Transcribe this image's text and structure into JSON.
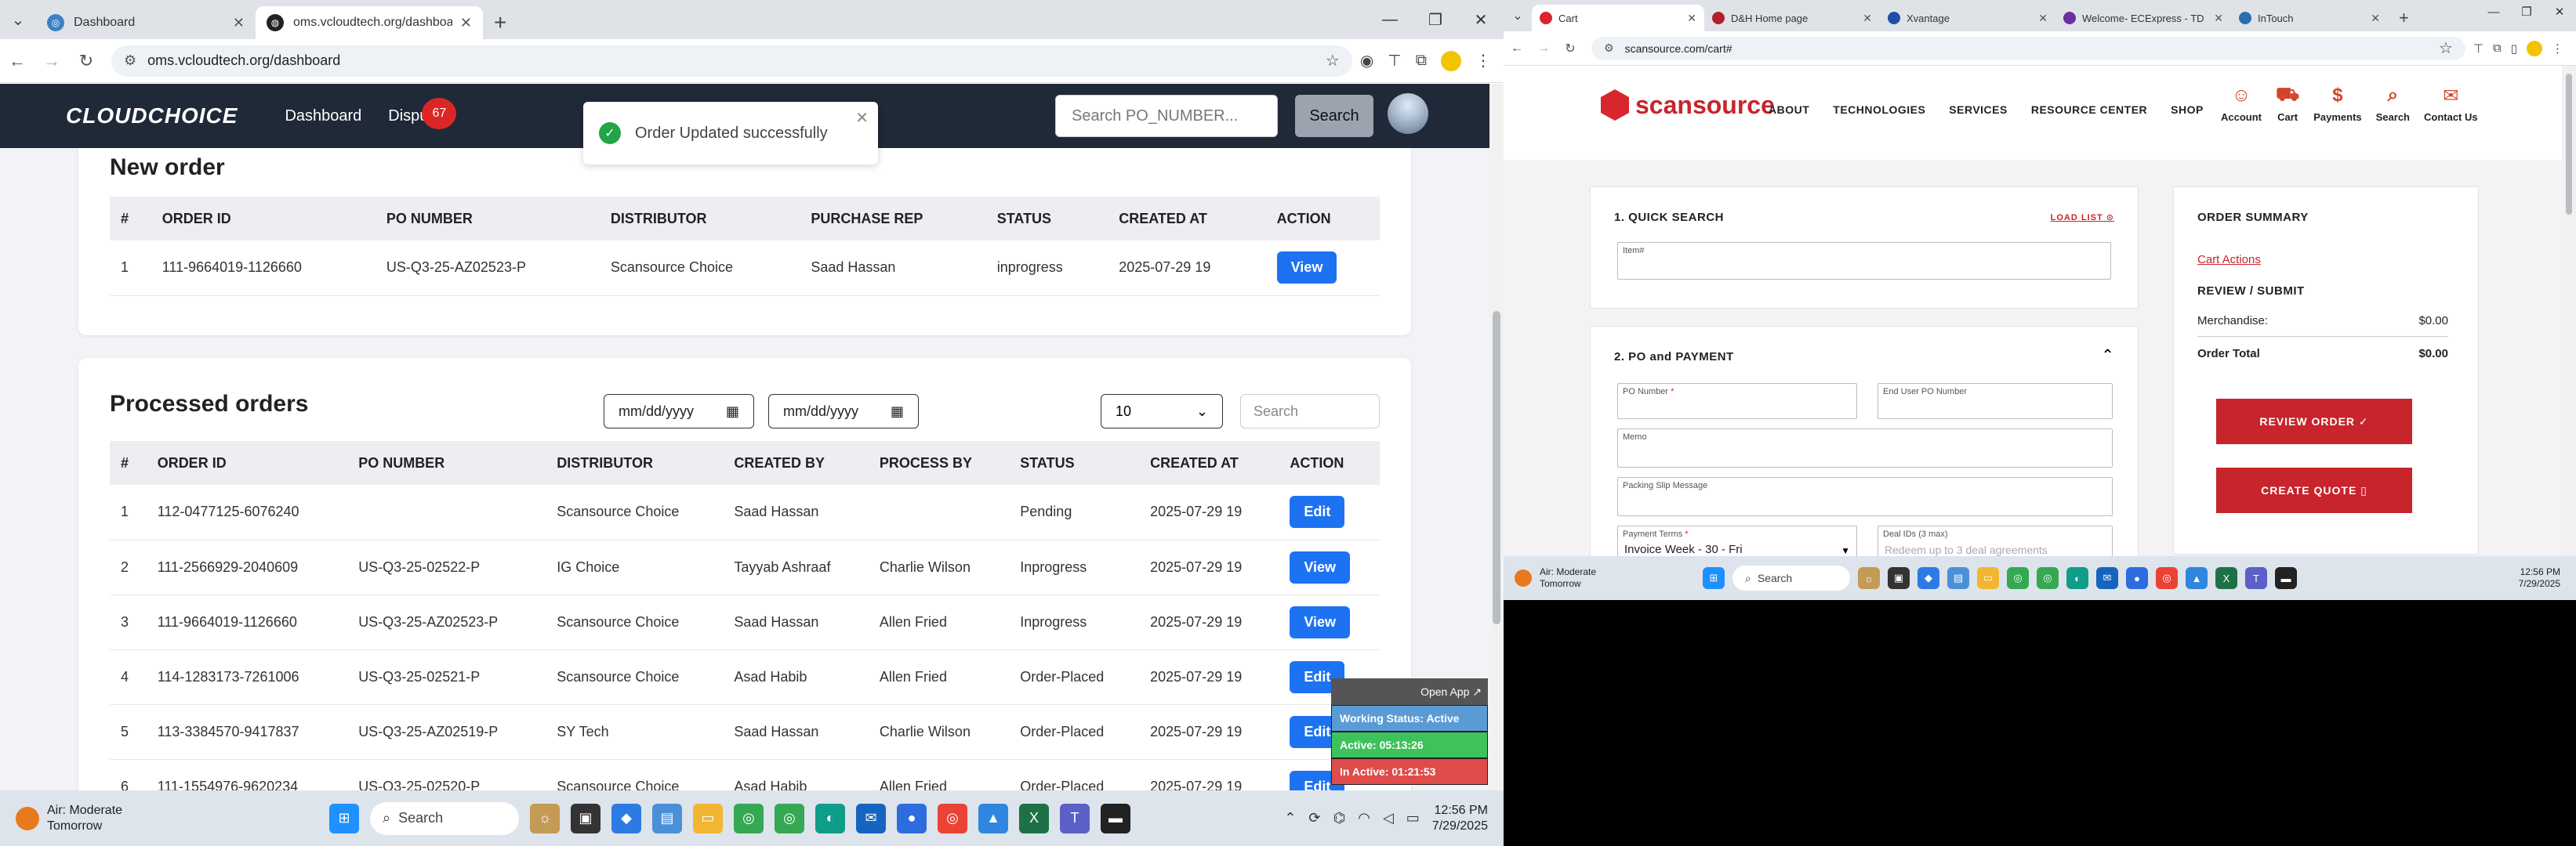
{
  "left": {
    "tabs": [
      {
        "title": "Dashboard",
        "color": "#3b82c4",
        "active": false
      },
      {
        "title": "oms.vcloudtech.org/dashboard",
        "color": "#222222",
        "active": true
      }
    ],
    "url": "oms.vcloudtech.org/dashboard",
    "app": {
      "logo": "CLOUDCHOICE",
      "nav_dashboard": "Dashboard",
      "nav_disputes": "Dispu",
      "disputes_badge": "67",
      "search_placeholder": "Search PO_NUMBER...",
      "search_button": "Search"
    },
    "toast": {
      "message": "Order Updated successfully"
    },
    "new_order": {
      "title": "New order",
      "columns": [
        "#",
        "ORDER ID",
        "PO NUMBER",
        "DISTRIBUTOR",
        "PURCHASE REP",
        "STATUS",
        "CREATED AT",
        "ACTION"
      ],
      "rows": [
        {
          "n": "1",
          "order_id": "111-9664019-1126660",
          "po": "US-Q3-25-AZ02523-P",
          "distributor": "Scansource Choice",
          "rep": "Saad Hassan",
          "status": "inprogress",
          "created": "2025-07-29 19",
          "action": "View"
        }
      ]
    },
    "processed": {
      "title": "Processed orders",
      "date_from": "mm/dd/yyyy",
      "date_to": "mm/dd/yyyy",
      "page_size": "10",
      "search_placeholder": "Search",
      "columns": [
        "#",
        "ORDER ID",
        "PO NUMBER",
        "DISTRIBUTOR",
        "CREATED BY",
        "PROCESS BY",
        "STATUS",
        "CREATED AT",
        "ACTION"
      ],
      "rows": [
        {
          "n": "1",
          "order_id": "112-0477125-6076240",
          "po": "",
          "distributor": "Scansource Choice",
          "created_by": "Saad Hassan",
          "process_by": "",
          "status": "Pending",
          "created": "2025-07-29 19",
          "action": "Edit"
        },
        {
          "n": "2",
          "order_id": "111-2566929-2040609",
          "po": "US-Q3-25-02522-P",
          "distributor": "IG Choice",
          "created_by": "Tayyab Ashraaf",
          "process_by": "Charlie Wilson",
          "status": "Inprogress",
          "created": "2025-07-29 19",
          "action": "View"
        },
        {
          "n": "3",
          "order_id": "111-9664019-1126660",
          "po": "US-Q3-25-AZ02523-P",
          "distributor": "Scansource Choice",
          "created_by": "Saad Hassan",
          "process_by": "Allen Fried",
          "status": "Inprogress",
          "created": "2025-07-29 19",
          "action": "View"
        },
        {
          "n": "4",
          "order_id": "114-1283173-7261006",
          "po": "US-Q3-25-02521-P",
          "distributor": "Scansource Choice",
          "created_by": "Asad Habib",
          "process_by": "Allen Fried",
          "status": "Order-Placed",
          "created": "2025-07-29 19",
          "action": "Edit"
        },
        {
          "n": "5",
          "order_id": "113-3384570-9417837",
          "po": "US-Q3-25-AZ02519-P",
          "distributor": "SY Tech",
          "created_by": "Saad Hassan",
          "process_by": "Charlie Wilson",
          "status": "Order-Placed",
          "created": "2025-07-29 19",
          "action": "Edit"
        },
        {
          "n": "6",
          "order_id": "111-1554976-9620234",
          "po": "US-Q3-25-02520-P",
          "distributor": "Scansource Choice",
          "created_by": "Asad Habib",
          "process_by": "Allen Fried",
          "status": "Order-Placed",
          "created": "2025-07-29 19",
          "action": "Edit"
        }
      ]
    },
    "status_widget": {
      "open_app": "Open App ↗",
      "working": "Working Status: Active",
      "active": "Active: 05:13:26",
      "inactive": "In Active: 01:21:53"
    },
    "taskbar": {
      "weather": "Air: Moderate",
      "weather_sub": "Tomorrow",
      "search": "Search",
      "time": "12:56 PM",
      "date": "7/29/2025"
    }
  },
  "right": {
    "tabs": [
      {
        "title": "Cart",
        "color": "#d7262d",
        "active": true
      },
      {
        "title": "D&H Home page",
        "color": "#b3202a",
        "active": false
      },
      {
        "title": "Xvantage",
        "color": "#1f4fa8",
        "active": false
      },
      {
        "title": "Welcome- ECExpress - TD S",
        "color": "#6a2fa0",
        "active": false
      },
      {
        "title": "InTouch",
        "color": "#2b6cb0",
        "active": false
      }
    ],
    "url": "scansource.com/cart#",
    "site": {
      "logo": "scansource",
      "menu": [
        "ABOUT",
        "TECHNOLOGIES",
        "SERVICES",
        "RESOURCE CENTER",
        "SHOP"
      ],
      "icons": [
        {
          "label": "Account",
          "icon": "account-icon"
        },
        {
          "label": "Cart",
          "icon": "cart-icon"
        },
        {
          "label": "Payments",
          "icon": "dollar-icon"
        },
        {
          "label": "Search",
          "icon": "search-icon"
        },
        {
          "label": "Contact Us",
          "icon": "chat-icon"
        }
      ]
    },
    "quick_search": {
      "title": "1. QUICK SEARCH",
      "load_list": "LOAD LIST",
      "item_label": "Item#"
    },
    "po_payment": {
      "title": "2. PO and PAYMENT",
      "po_number_label": "PO Number",
      "end_user_po_label": "End User PO Number",
      "memo_label": "Memo",
      "packing_slip_label": "Packing Slip Message",
      "payment_terms_label": "Payment Terms",
      "payment_terms_value": "Invoice Week - 30 - Fri",
      "deal_ids_label": "Deal IDs (3 max)",
      "deal_ids_placeholder": "Redeem up to 3 deal agreements"
    },
    "summary": {
      "title": "ORDER SUMMARY",
      "cart_actions": "Cart Actions",
      "review_submit": "REVIEW / SUBMIT",
      "merchandise_label": "Merchandise:",
      "merchandise_value": "$0.00",
      "total_label": "Order Total",
      "total_value": "$0.00",
      "review_button": "REVIEW ORDER ✓",
      "quote_button": "CREATE QUOTE ▯"
    },
    "taskbar": {
      "weather": "Air: Moderate",
      "weather_sub": "Tomorrow",
      "search": "Search",
      "time": "12:56 PM",
      "date": "7/29/2025"
    }
  }
}
